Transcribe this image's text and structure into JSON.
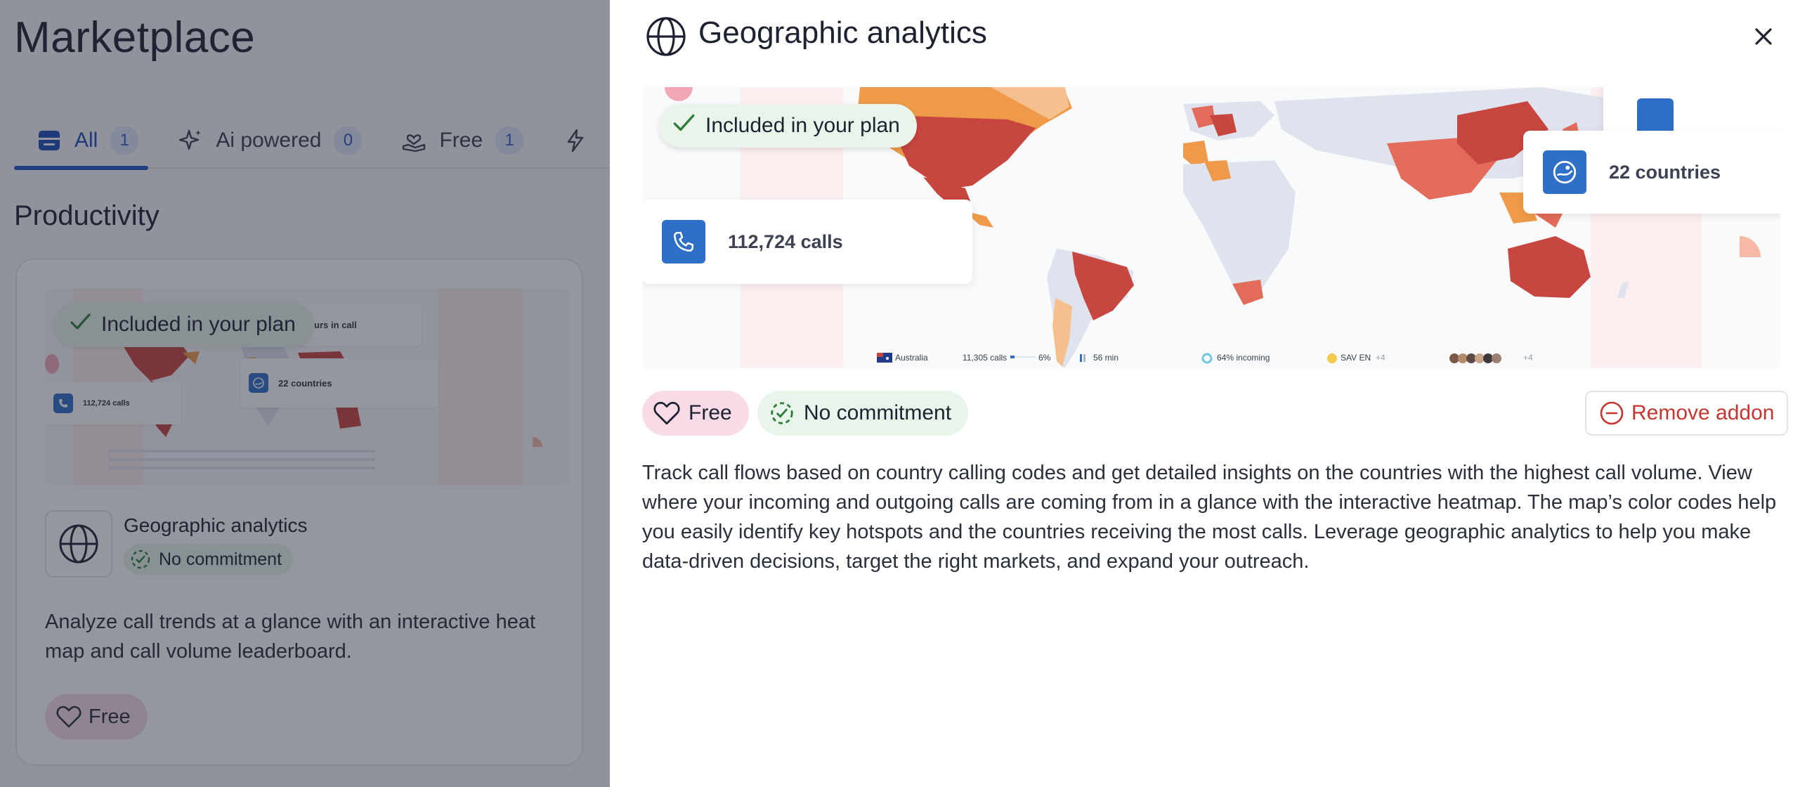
{
  "page": {
    "title": "Marketplace",
    "tabs": [
      {
        "label": "All",
        "count": "1",
        "icon": "storefront-icon"
      },
      {
        "label": "Ai powered",
        "count": "0",
        "icon": "sparkle-icon"
      },
      {
        "label": "Free",
        "count": "1",
        "icon": "hand-heart-icon"
      }
    ],
    "section_title": "Productivity"
  },
  "card": {
    "included_label": "Included in your plan",
    "name": "Geographic analytics",
    "commitment": "No commitment",
    "description": "Analyze call trends at a glance with an interactive heat map and call volume leaderboard.",
    "price": "Free",
    "preview": {
      "hours": "224 hours in call",
      "countries": "22 countries",
      "calls": "112,724 calls"
    }
  },
  "drawer": {
    "title": "Geographic analytics",
    "hero": {
      "included_label": "Included in your plan",
      "calls": "112,724 calls",
      "countries": "22 countries",
      "legend": {
        "country": "Australia",
        "calls": "11,305 calls",
        "calls_pct": "6%",
        "duration": "56 min",
        "incoming": "64% incoming",
        "language": "SAV EN",
        "language_more": "+4",
        "avatars_more": "+4"
      }
    },
    "price": "Free",
    "commitment": "No commitment",
    "remove_label": "Remove addon",
    "description": "Track call flows based on country calling codes and get detailed insights on the countries with the highest call volume. View where your incoming and outgoing calls are coming from in a glance with the interactive heatmap. The map’s color codes help you easily identify key hotspots and the countries receiving the most calls. Leverage geographic analytics to help you make data-driven decisions, target the right markets, and expand your outreach."
  },
  "colors": {
    "accent": "#2458c6",
    "stat_icon": "#2e6fc7",
    "free_chip": "#f8dbe6",
    "commitment_chip": "#e9f4ea",
    "remove": "#c6352f",
    "map_dark": "#c7463f",
    "map_mid": "#e26b5a",
    "map_orange": "#ee9a4a",
    "map_light": "#f6c08e",
    "map_neutral": "#dfe3ee"
  }
}
